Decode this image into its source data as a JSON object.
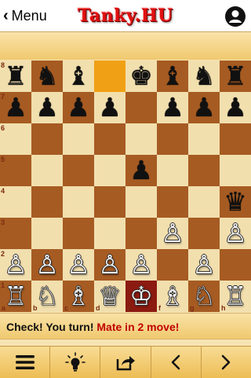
{
  "header": {
    "menu_label": "Menu",
    "logo_text": "Tanky.HU"
  },
  "board": {
    "ranks": [
      "8",
      "7",
      "6",
      "5",
      "4",
      "3",
      "2",
      "1"
    ],
    "files": [
      "a",
      "b",
      "c",
      "d",
      "e",
      "f",
      "g",
      "h"
    ],
    "selected_square": "d8",
    "check_square": "e1",
    "pieces": [
      {
        "sq": "a8",
        "p": "♜",
        "c": "b",
        "name": "black-rook"
      },
      {
        "sq": "b8",
        "p": "♞",
        "c": "b",
        "name": "black-knight"
      },
      {
        "sq": "c8",
        "p": "♝",
        "c": "b",
        "name": "black-bishop"
      },
      {
        "sq": "e8",
        "p": "♚",
        "c": "b",
        "name": "black-king"
      },
      {
        "sq": "f8",
        "p": "♝",
        "c": "b",
        "name": "black-bishop"
      },
      {
        "sq": "g8",
        "p": "♞",
        "c": "b",
        "name": "black-knight"
      },
      {
        "sq": "h8",
        "p": "♜",
        "c": "b",
        "name": "black-rook"
      },
      {
        "sq": "a7",
        "p": "♟",
        "c": "b",
        "name": "black-pawn"
      },
      {
        "sq": "b7",
        "p": "♟",
        "c": "b",
        "name": "black-pawn"
      },
      {
        "sq": "c7",
        "p": "♟",
        "c": "b",
        "name": "black-pawn"
      },
      {
        "sq": "d7",
        "p": "♟",
        "c": "b",
        "name": "black-pawn"
      },
      {
        "sq": "f7",
        "p": "♟",
        "c": "b",
        "name": "black-pawn"
      },
      {
        "sq": "g7",
        "p": "♟",
        "c": "b",
        "name": "black-pawn"
      },
      {
        "sq": "h7",
        "p": "♟",
        "c": "b",
        "name": "black-pawn"
      },
      {
        "sq": "e5",
        "p": "♟",
        "c": "b",
        "name": "black-pawn"
      },
      {
        "sq": "h4",
        "p": "♛",
        "c": "b",
        "name": "black-queen"
      },
      {
        "sq": "f3",
        "p": "♙",
        "c": "w",
        "name": "white-pawn"
      },
      {
        "sq": "h3",
        "p": "♙",
        "c": "w",
        "name": "white-pawn"
      },
      {
        "sq": "a2",
        "p": "♙",
        "c": "w",
        "name": "white-pawn"
      },
      {
        "sq": "b2",
        "p": "♙",
        "c": "w",
        "name": "white-pawn"
      },
      {
        "sq": "c2",
        "p": "♙",
        "c": "w",
        "name": "white-pawn"
      },
      {
        "sq": "d2",
        "p": "♙",
        "c": "w",
        "name": "white-pawn"
      },
      {
        "sq": "e2",
        "p": "♙",
        "c": "w",
        "name": "white-pawn"
      },
      {
        "sq": "g2",
        "p": "♙",
        "c": "w",
        "name": "white-pawn"
      },
      {
        "sq": "a1",
        "p": "♖",
        "c": "w",
        "name": "white-rook"
      },
      {
        "sq": "b1",
        "p": "♘",
        "c": "w",
        "name": "white-knight"
      },
      {
        "sq": "c1",
        "p": "♗",
        "c": "w",
        "name": "white-bishop"
      },
      {
        "sq": "d1",
        "p": "♕",
        "c": "w",
        "name": "white-queen"
      },
      {
        "sq": "e1",
        "p": "♔",
        "c": "w",
        "name": "white-king"
      },
      {
        "sq": "f1",
        "p": "♗",
        "c": "w",
        "name": "white-bishop"
      },
      {
        "sq": "g1",
        "p": "♘",
        "c": "w",
        "name": "white-knight"
      },
      {
        "sq": "h1",
        "p": "♖",
        "c": "w",
        "name": "white-rook"
      }
    ]
  },
  "status": {
    "check_text": "Check! You turn!",
    "mate_text": "Mate in 2 move!"
  },
  "toolbar": {
    "buttons": [
      "menu-icon",
      "hint-bulb-icon",
      "share-icon",
      "previous-icon",
      "next-icon"
    ]
  },
  "colors": {
    "light_square": "#f2dfae",
    "dark_square": "#a65b22",
    "selected": "#f0a014",
    "check": "#8b1a10",
    "accent_red": "#c00000"
  }
}
